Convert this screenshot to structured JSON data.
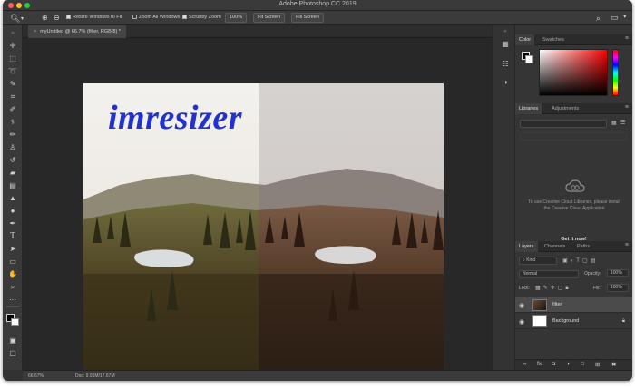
{
  "window": {
    "title": "Adobe Photoshop CC 2019",
    "traffic_colors": [
      "#ff5f57",
      "#febc2e",
      "#28c840"
    ]
  },
  "options_bar": {
    "resize_windows": "Resize Windows to Fit",
    "zoom_all": "Zoom All Windows",
    "scrubby_zoom": "Scrubby Zoom",
    "zoom_value": "100%",
    "fit_screen": "Fit Screen",
    "fill_screen": "Fill Screen"
  },
  "document": {
    "tab_label": "myUntitled @ 66.7% (filter, RGB/8) *",
    "watermark": "imresizer"
  },
  "status_bar": {
    "zoom": "66.67%",
    "doc_info": "Doc: 9.91M/17.67M"
  },
  "color_panel": {
    "tabs": [
      "Color",
      "Swatches"
    ],
    "foreground": "#000000",
    "background": "#ffffff"
  },
  "libraries_panel": {
    "tabs": [
      "Libraries",
      "Adjustments"
    ],
    "message": "To use Creative Cloud Libraries, please install the Creative Cloud Application",
    "get_it_now": "Get it now!"
  },
  "layers_panel": {
    "tabs": [
      "Layers",
      "Channels",
      "Paths"
    ],
    "kind_filter": "Kind",
    "blend_mode": "Normal",
    "opacity_label": "Opacity:",
    "opacity_value": "100%",
    "lock_label": "Lock:",
    "fill_label": "Fill:",
    "fill_value": "100%",
    "layers": [
      {
        "name": "filter",
        "selected": true
      },
      {
        "name": "Background",
        "selected": false
      }
    ]
  }
}
